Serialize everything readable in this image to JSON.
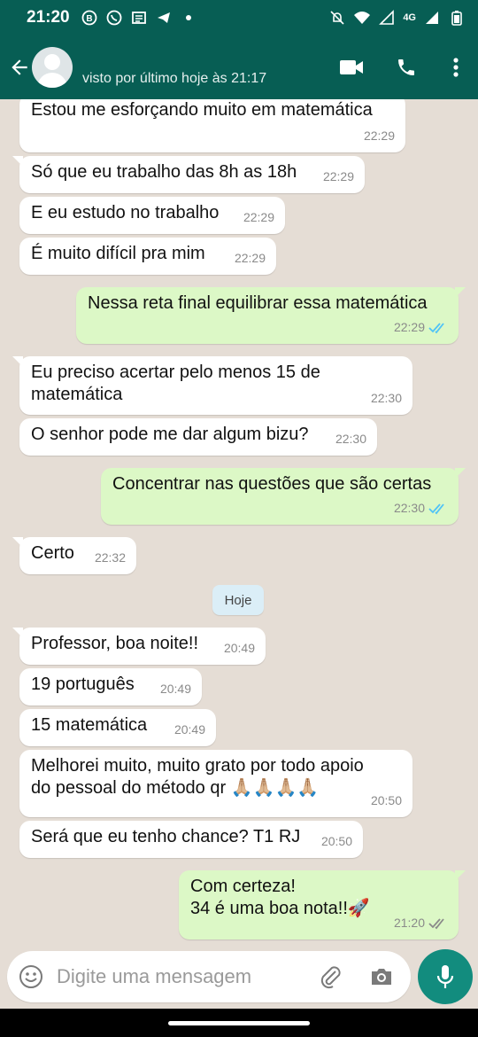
{
  "status_bar": {
    "time": "21:20",
    "network": "4G",
    "left_icons": [
      "b-badge-icon",
      "whatsapp-icon",
      "news-icon",
      "telegram-icon",
      "dot-icon"
    ],
    "right_icons": [
      "mute-icon",
      "wifi-icon",
      "signal-icon",
      "signal-icon",
      "battery-icon"
    ]
  },
  "header": {
    "last_seen": "visto por último hoje às 21:17"
  },
  "messages": [
    {
      "dir": "in",
      "text": "Estou me esforçando muito em matemática",
      "time": "22:29"
    },
    {
      "dir": "in",
      "text": "Só que eu trabalho das 8h as 18h",
      "time": "22:29"
    },
    {
      "dir": "in",
      "text": "E eu estudo no trabalho",
      "time": "22:29"
    },
    {
      "dir": "in",
      "text": "É muito difícil pra mim",
      "time": "22:29"
    },
    {
      "dir": "out",
      "text": "Nessa reta final equilibrar essa matemática",
      "time": "22:29",
      "status": "read"
    },
    {
      "dir": "in",
      "text": "Eu preciso acertar pelo menos 15 de\nmatemática",
      "time": "22:30"
    },
    {
      "dir": "in",
      "text": "O senhor pode me dar algum bizu?",
      "time": "22:30"
    },
    {
      "dir": "out",
      "text": "Concentrar nas questões que são certas",
      "time": "22:30",
      "status": "read"
    },
    {
      "dir": "in",
      "text": "Certo",
      "time": "22:32"
    },
    {
      "dir": "in",
      "text": "Professor, boa noite!!",
      "time": "20:49"
    },
    {
      "dir": "in",
      "text": "19 português",
      "time": "20:49"
    },
    {
      "dir": "in",
      "text": "15 matemática",
      "time": "20:49"
    },
    {
      "dir": "in",
      "text": "Melhorei muito, muito grato por todo apoio\ndo pessoal do método qr 🙏🏼🙏🏼🙏🏼🙏🏼",
      "time": "20:50"
    },
    {
      "dir": "in",
      "text": "Será que eu tenho chance? T1 RJ",
      "time": "20:50"
    },
    {
      "dir": "out",
      "text": "Com certeza!\n34 é uma boa nota!!🚀",
      "time": "21:20",
      "status": "delivered"
    }
  ],
  "date_chip": "Hoje",
  "composer": {
    "placeholder": "Digite uma mensagem"
  },
  "colors": {
    "header": "#075e54",
    "outgoing": "#dcf8c6",
    "incoming": "#ffffff",
    "read_tick": "#4fc3f7",
    "mic": "#128c7e",
    "chat_bg": "#e5ddd5"
  }
}
